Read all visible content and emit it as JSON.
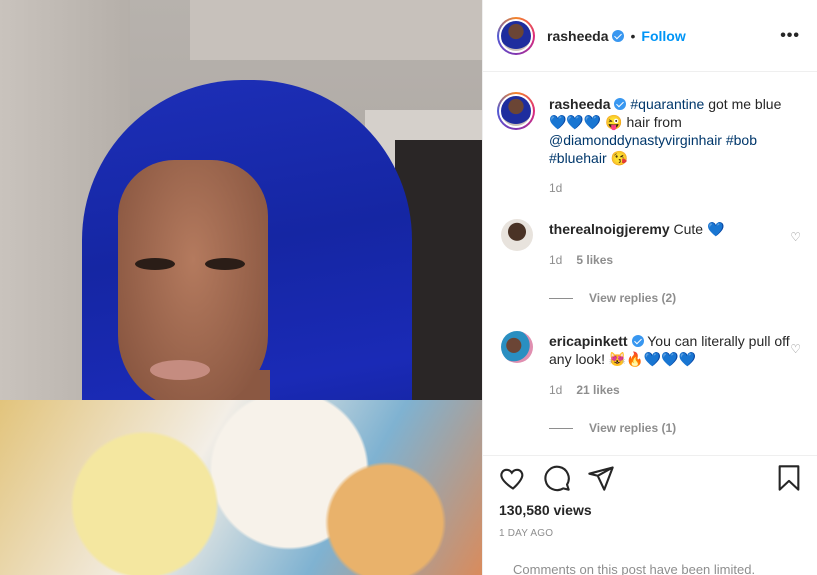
{
  "post": {
    "username": "rasheeda",
    "follow_label": "Follow",
    "separator": "•",
    "more_label": "•••"
  },
  "caption": {
    "username": "rasheeda",
    "parts": [
      "#quarantine",
      " got me blue 💙💙💙 😜 hair from ",
      "@diamonddynastyvirginhair",
      " ",
      "#bob",
      " ",
      "#bluehair",
      " 😘"
    ],
    "time": "1d"
  },
  "comments": [
    {
      "username": "therealnoigjeremy",
      "text": "Cute 💙",
      "time": "1d",
      "likes": "5 likes",
      "view_replies": "View replies (2)"
    },
    {
      "username": "ericapinkett",
      "text": "You can literally pull off any look! 😻🔥💙💙💙",
      "time": "1d",
      "likes": "21 likes",
      "view_replies": "View replies (1)"
    }
  ],
  "stats": {
    "views": "130,580 views",
    "posted": "1 DAY AGO",
    "footer_note": "Comments on this post have been limited."
  },
  "icons": {
    "verified": "verified-badge-icon",
    "like": "heart-icon",
    "comment": "comment-icon",
    "share": "paper-plane-icon",
    "save": "bookmark-icon"
  },
  "colors": {
    "link_blue": "#0095f6",
    "verified_blue": "#3897f0",
    "hashtag": "#00376b",
    "muted": "#8e8e8e"
  }
}
